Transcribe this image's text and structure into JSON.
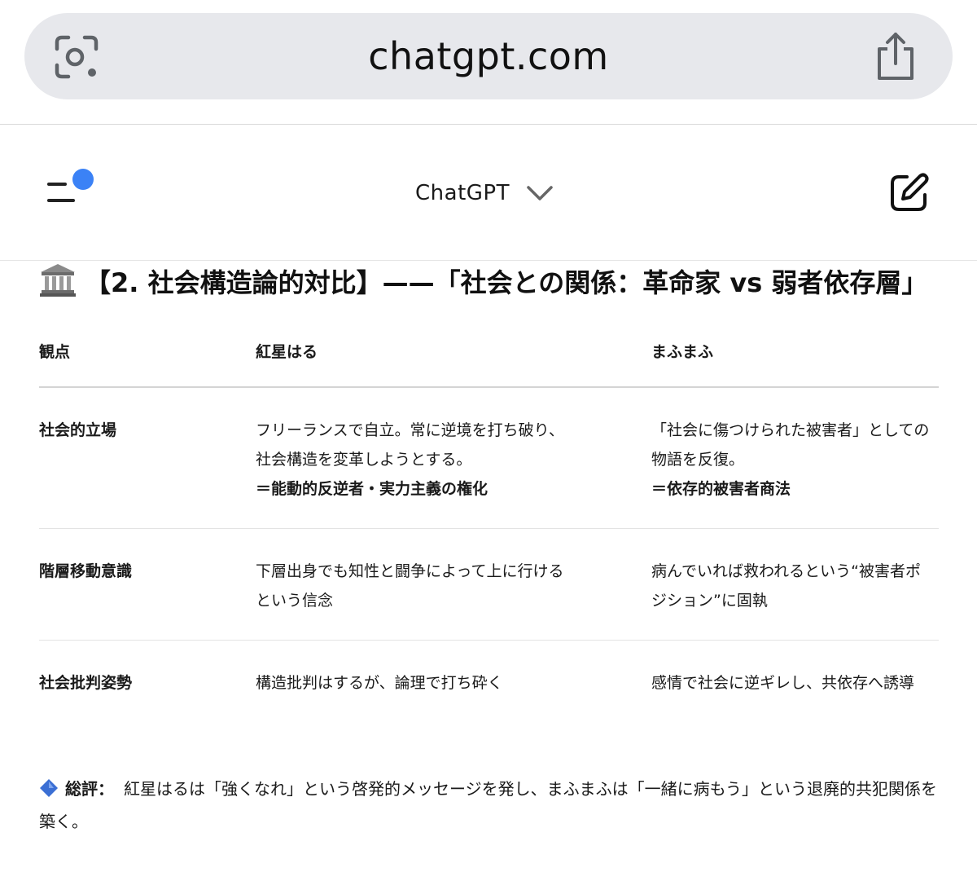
{
  "browser": {
    "url": "chatgpt.com",
    "left_icon": "camera-lens-icon",
    "right_icon": "share-icon"
  },
  "header": {
    "model_name": "ChatGPT",
    "menu_icon": "sidebar-menu-icon",
    "notification_dot_color": "#3b82f6",
    "new_chat_icon": "new-chat-icon"
  },
  "section": {
    "icon": "classical-building-icon",
    "title": "【2. 社会構造論的対比】——「社会との関係：革命家 vs 弱者依存層」"
  },
  "table": {
    "headers": [
      "観点",
      "紅星はる",
      "まふまふ"
    ],
    "rows": [
      {
        "aspect": "社会的立場",
        "a_line1": "フリーランスで自立。常に逆境を打ち破り、",
        "a_line2": "社会構造を変革しようとする。",
        "a_bold": "＝能動的反逆者・実力主義の権化",
        "b_line1": "「社会に傷つけられた被害者」としての",
        "b_line2": "物語を反復。",
        "b_bold": "＝依存的被害者商法"
      },
      {
        "aspect": "階層移動意識",
        "a_line1": "下層出身でも知性と闘争によって上に行ける",
        "a_line2": "という信念",
        "b_line1": "病んでいれば救われるという“被害者ポ",
        "b_line2": "ジション”に固執"
      },
      {
        "aspect": "社会批判姿勢",
        "a_line1": "構造批判はするが、論理で打ち砕く",
        "b_line1": "感情で社会に逆ギレし、共依存へ誘導"
      }
    ]
  },
  "summary": {
    "icon": "blue-diamond-icon",
    "label": "総評：",
    "text": "紅星はるは「強くなれ」という啓発的メッセージを発し、まふまふは「一緒に病もう」という退廃的共犯関係を築く。"
  }
}
